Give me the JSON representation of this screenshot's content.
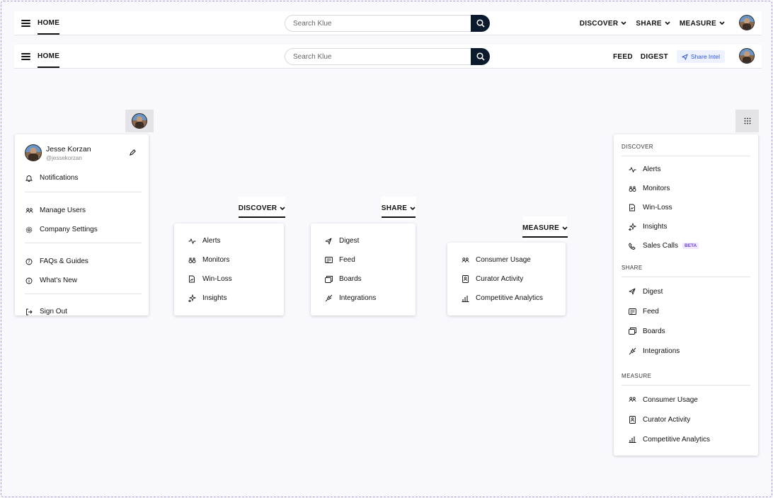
{
  "header": {
    "home_label": "HOME",
    "search_placeholder": "Search Klue",
    "nav": [
      {
        "label": "DISCOVER"
      },
      {
        "label": "SHARE"
      },
      {
        "label": "MEASURE"
      }
    ],
    "alt_nav": [
      {
        "label": "FEED"
      },
      {
        "label": "DIGEST"
      }
    ],
    "share_intel_label": "Share Intel"
  },
  "profile_menu": {
    "name": "Jesse Korzan",
    "handle": "@jessekorzan",
    "notifications": "Notifications",
    "manage_users": "Manage Users",
    "company_settings": "Company Settings",
    "faqs": "FAQs & Guides",
    "whats_new": "What's New",
    "sign_out": "Sign Out"
  },
  "discover_menu": {
    "trigger": "DISCOVER",
    "items": [
      "Alerts",
      "Monitors",
      "Win-Loss",
      "Insights"
    ]
  },
  "share_menu": {
    "trigger": "SHARE",
    "items": [
      "Digest",
      "Feed",
      "Boards",
      "Integrations"
    ]
  },
  "measure_menu": {
    "trigger": "MEASURE",
    "items": [
      "Consumer Usage",
      "Curator Activity",
      "Competitive Analytics"
    ]
  },
  "apps_menu": {
    "discover_heading": "DISCOVER",
    "discover_items": [
      "Alerts",
      "Monitors",
      "Win-Loss",
      "Insights",
      "Sales Calls"
    ],
    "beta_badge": "BETA",
    "share_heading": "SHARE",
    "share_items": [
      "Digest",
      "Feed",
      "Boards",
      "Integrations"
    ],
    "measure_heading": "MEASURE",
    "measure_items": [
      "Consumer Usage",
      "Curator Activity",
      "Competitive Analytics"
    ]
  },
  "colors": {
    "background": "#f8f8fd",
    "search_button": "#0c1a2e",
    "share_intel": "#2f55d4",
    "frame_border": "#a99be0"
  }
}
